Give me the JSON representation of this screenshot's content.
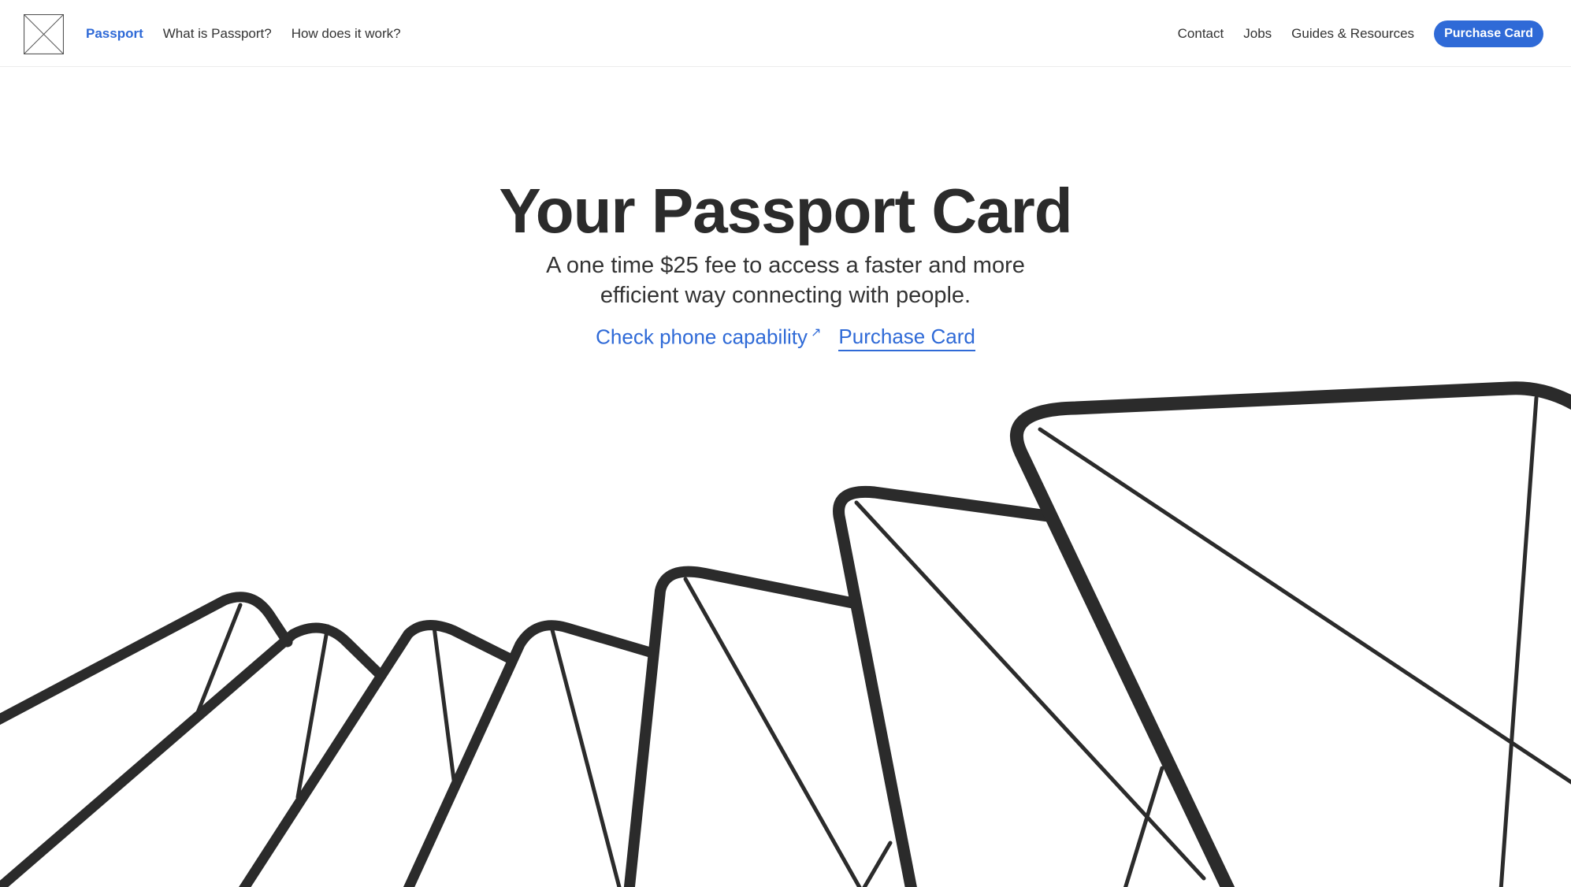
{
  "nav": {
    "brand": "Passport",
    "what_is": "What is Passport?",
    "how_works": "How does it work?",
    "contact": "Contact",
    "jobs": "Jobs",
    "guides": "Guides & Resources",
    "purchase": "Purchase Card"
  },
  "hero": {
    "title": "Your Passport Card",
    "subtitle_line1": "A one time $25 fee to access a faster and more",
    "subtitle_line2": "efficient way connecting with people.",
    "check_link": "Check phone capability",
    "purchase_link": "Purchase Card"
  },
  "colors": {
    "accent": "#2f6ad7",
    "text": "#2b2b2b",
    "illustration": "#2b2b2b"
  },
  "icons": {
    "logo": "placeholder-x-icon",
    "external": "arrow-up-right-icon"
  }
}
